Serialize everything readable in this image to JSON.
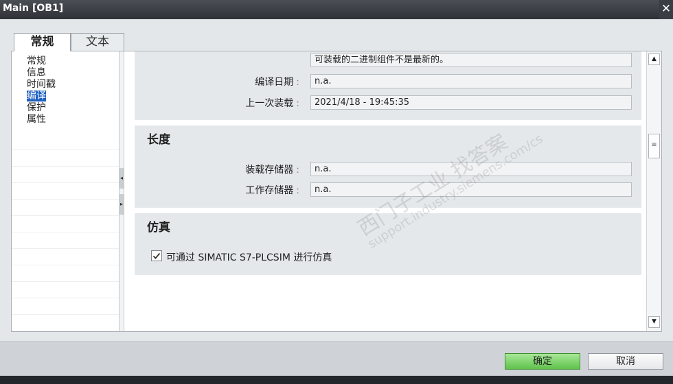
{
  "window": {
    "title": "Main [OB1]",
    "close_glyph": "✕"
  },
  "tabs": [
    {
      "label": "常规",
      "active": true
    },
    {
      "label": "文本",
      "active": false
    }
  ],
  "nav": {
    "items": [
      {
        "label": "常规"
      },
      {
        "label": "信息"
      },
      {
        "label": "时间戳"
      },
      {
        "label": "编译",
        "selected": true
      },
      {
        "label": "保护"
      },
      {
        "label": "属性"
      }
    ]
  },
  "compile": {
    "status_value": "可装载的二进制组件不是最新的。",
    "date_label": "编译日期",
    "date_value": "n.a.",
    "last_load_label": "上一次装载",
    "last_load_value": "2021/4/18 - 19:45:35"
  },
  "length": {
    "title": "长度",
    "load_mem_label": "装载存储器",
    "load_mem_value": "n.a.",
    "work_mem_label": "工作存储器",
    "work_mem_value": "n.a."
  },
  "simulation": {
    "title": "仿真",
    "checkbox_checked": true,
    "checkbox_label": "可通过 SIMATIC S7-PLCSIM 进行仿真"
  },
  "watermark": {
    "line1": "西门子工业  找答案",
    "line2": "support.industry.siemens.com/cs"
  },
  "footer": {
    "ok_label": "确定",
    "cancel_label": "取消"
  },
  "colors": {
    "ok_button": "#5fc24c",
    "selection": "#1d5fbf",
    "titlebar": "#2f3338"
  }
}
